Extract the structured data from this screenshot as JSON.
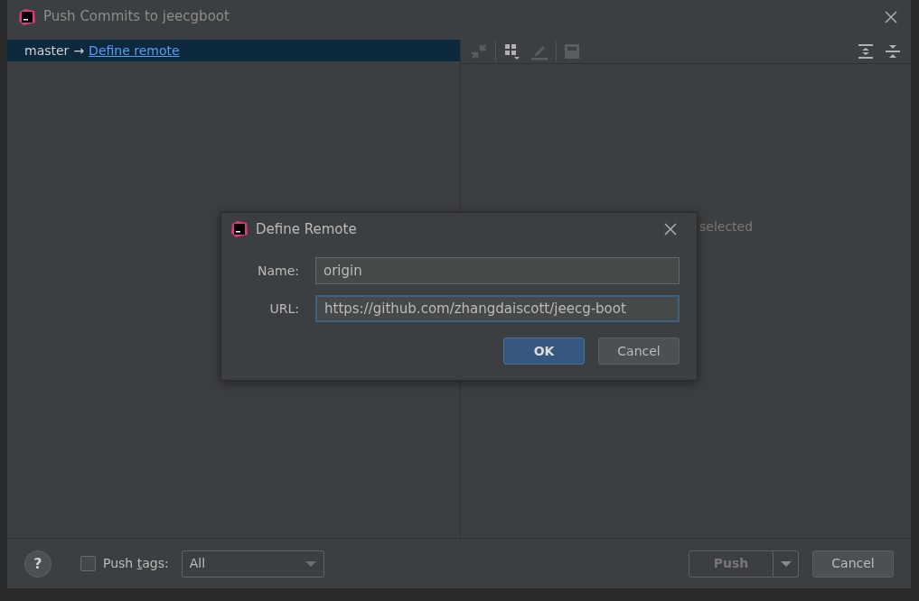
{
  "window": {
    "title": "Push Commits to jeecgboot"
  },
  "branch_row": {
    "branch": "master",
    "arrow": "→",
    "link": "Define remote",
    "selected": true
  },
  "details_panel": {
    "empty_text": "selected"
  },
  "define_remote": {
    "title": "Define Remote",
    "fields": [
      {
        "label": "Name:",
        "value": "origin",
        "focused": false
      },
      {
        "label": "URL:",
        "value": "https://github.com/zhangdaiscott/jeecg-boot",
        "focused": true
      }
    ],
    "buttons": [
      {
        "label": "OK",
        "kind": "primary"
      },
      {
        "label": "Cancel",
        "kind": "secondary"
      }
    ]
  },
  "footer": {
    "help": "?",
    "push_tags": {
      "checked": false,
      "label_parts": [
        "Push ",
        "t",
        "ags:"
      ]
    },
    "tags_select": "All",
    "push_button": {
      "label": "Push",
      "disabled": true
    },
    "cancel_button": "Cancel"
  }
}
